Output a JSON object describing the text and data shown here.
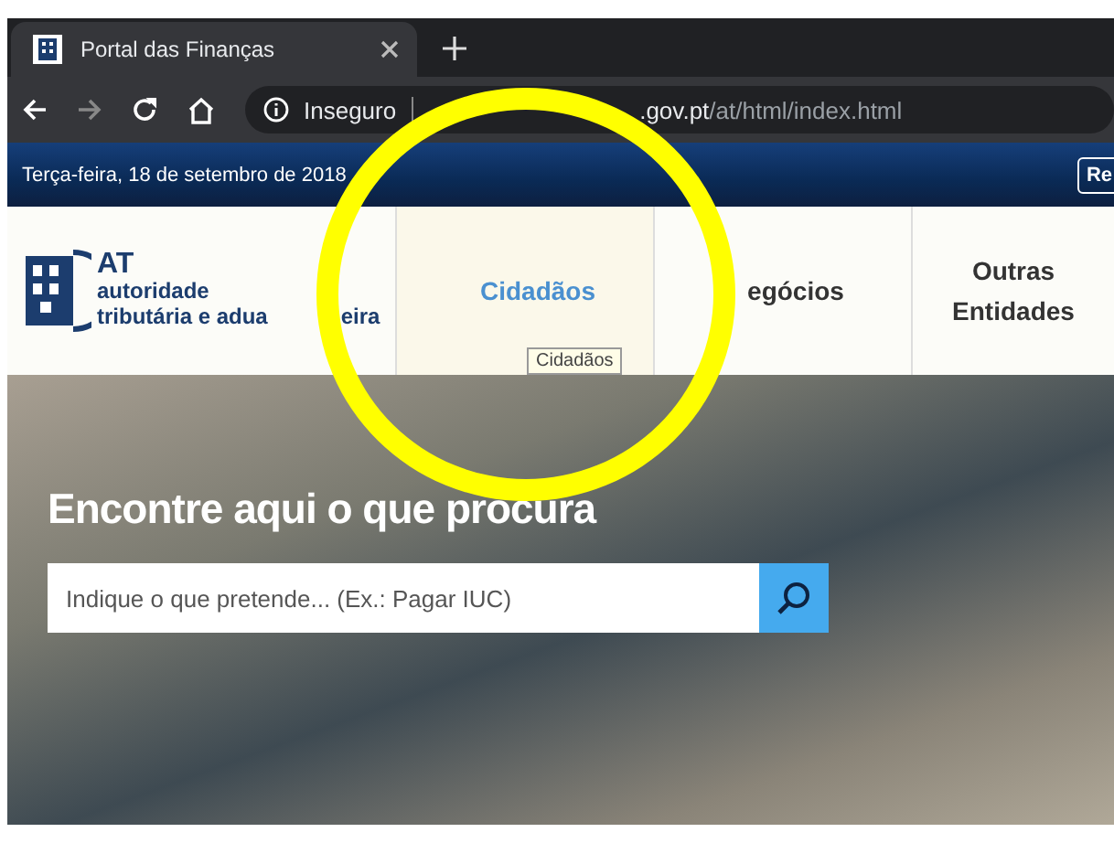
{
  "browser": {
    "tab": {
      "title": "Portal das Finanças",
      "selected": true
    },
    "security": "Inseguro",
    "url_host": ".gov.pt",
    "url_path": "/at/html/index.html"
  },
  "top_bar": {
    "date": "Terça-feira, 18 de setembro de 2018",
    "button": "Re"
  },
  "logo": {
    "acronym": "AT",
    "line_1": "autoridade",
    "line_2": "tributária e adua",
    "line_2_end": "eira"
  },
  "nav": [
    {
      "label": "Cidadãos",
      "selected": true
    },
    {
      "label": "egócios",
      "selected": false
    },
    {
      "label": "Outras Entidades",
      "selected": false
    }
  ],
  "tooltip": "Cidadãos",
  "hero": {
    "heading": "Encontre aqui o que procura",
    "search": {
      "placeholder": "Indique o que pretende... (Ex.: Pagar IUC)"
    }
  }
}
